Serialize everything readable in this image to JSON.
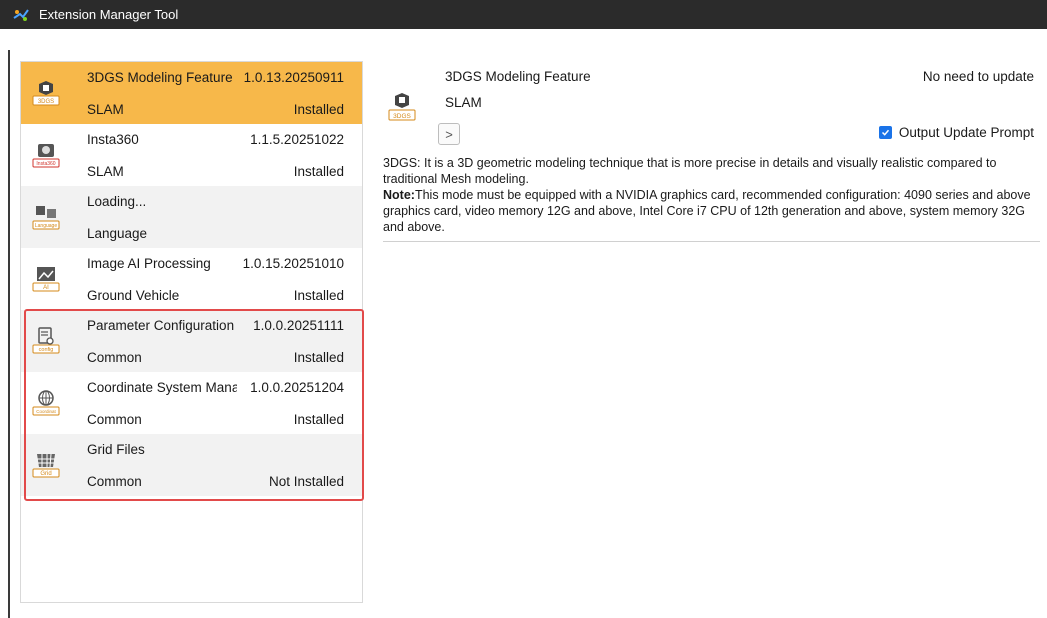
{
  "window": {
    "title": "Extension Manager Tool"
  },
  "extensions": [
    {
      "name": "3DGS Modeling Feature",
      "version": "1.0.13.20250911",
      "category": "SLAM",
      "status": "Installed",
      "icon": "3dgs-icon",
      "icon_label": "3DGS",
      "selected": true
    },
    {
      "name": "Insta360",
      "version": "1.1.5.20251022",
      "category": "SLAM",
      "status": "Installed",
      "icon": "insta360-icon",
      "icon_label": "Insta360"
    },
    {
      "name": "Loading...",
      "version": "",
      "category": "Language",
      "status": "",
      "icon": "language-icon",
      "icon_label": "Language"
    },
    {
      "name": "Image AI Processing",
      "version": "1.0.15.20251010",
      "category": "Ground Vehicle",
      "status": "Installed",
      "icon": "ai-image-icon",
      "icon_label": "AI"
    },
    {
      "name": "Parameter Configuration",
      "version": "1.0.0.20251111",
      "category": "Common",
      "status": "Installed",
      "icon": "config-icon",
      "icon_label": "config"
    },
    {
      "name": "Coordinate System Manag",
      "version": "1.0.0.20251204",
      "category": "Common",
      "status": "Installed",
      "icon": "coordinate-icon",
      "icon_label": "Coordinat"
    },
    {
      "name": "Grid Files",
      "version": "",
      "category": "Common",
      "status": "Not Installed",
      "icon": "grid-icon",
      "icon_label": "Grid"
    }
  ],
  "detail": {
    "name": "3DGS Modeling Feature",
    "category": "SLAM",
    "update_status": "No need to update",
    "icon_label": "3DGS",
    "output_prompt_label": "Output Update Prompt",
    "output_prompt_checked": true,
    "expand_glyph": ">",
    "description": "3DGS: It is a 3D geometric modeling technique that is more precise in details and visually realistic compared to traditional Mesh modeling.",
    "note_label": "Note:",
    "note_text": "This mode must be equipped with a NVIDIA graphics card, recommended configuration: 4090 series and above graphics card, video memory 12G and above, Intel Core i7 CPU of 12th generation and above, system memory 32G and above."
  },
  "colors": {
    "selected": "#f7b84a",
    "highlight": "#e24a4a",
    "checkbox": "#1a73e8",
    "titlebar": "#2b2b2b"
  }
}
